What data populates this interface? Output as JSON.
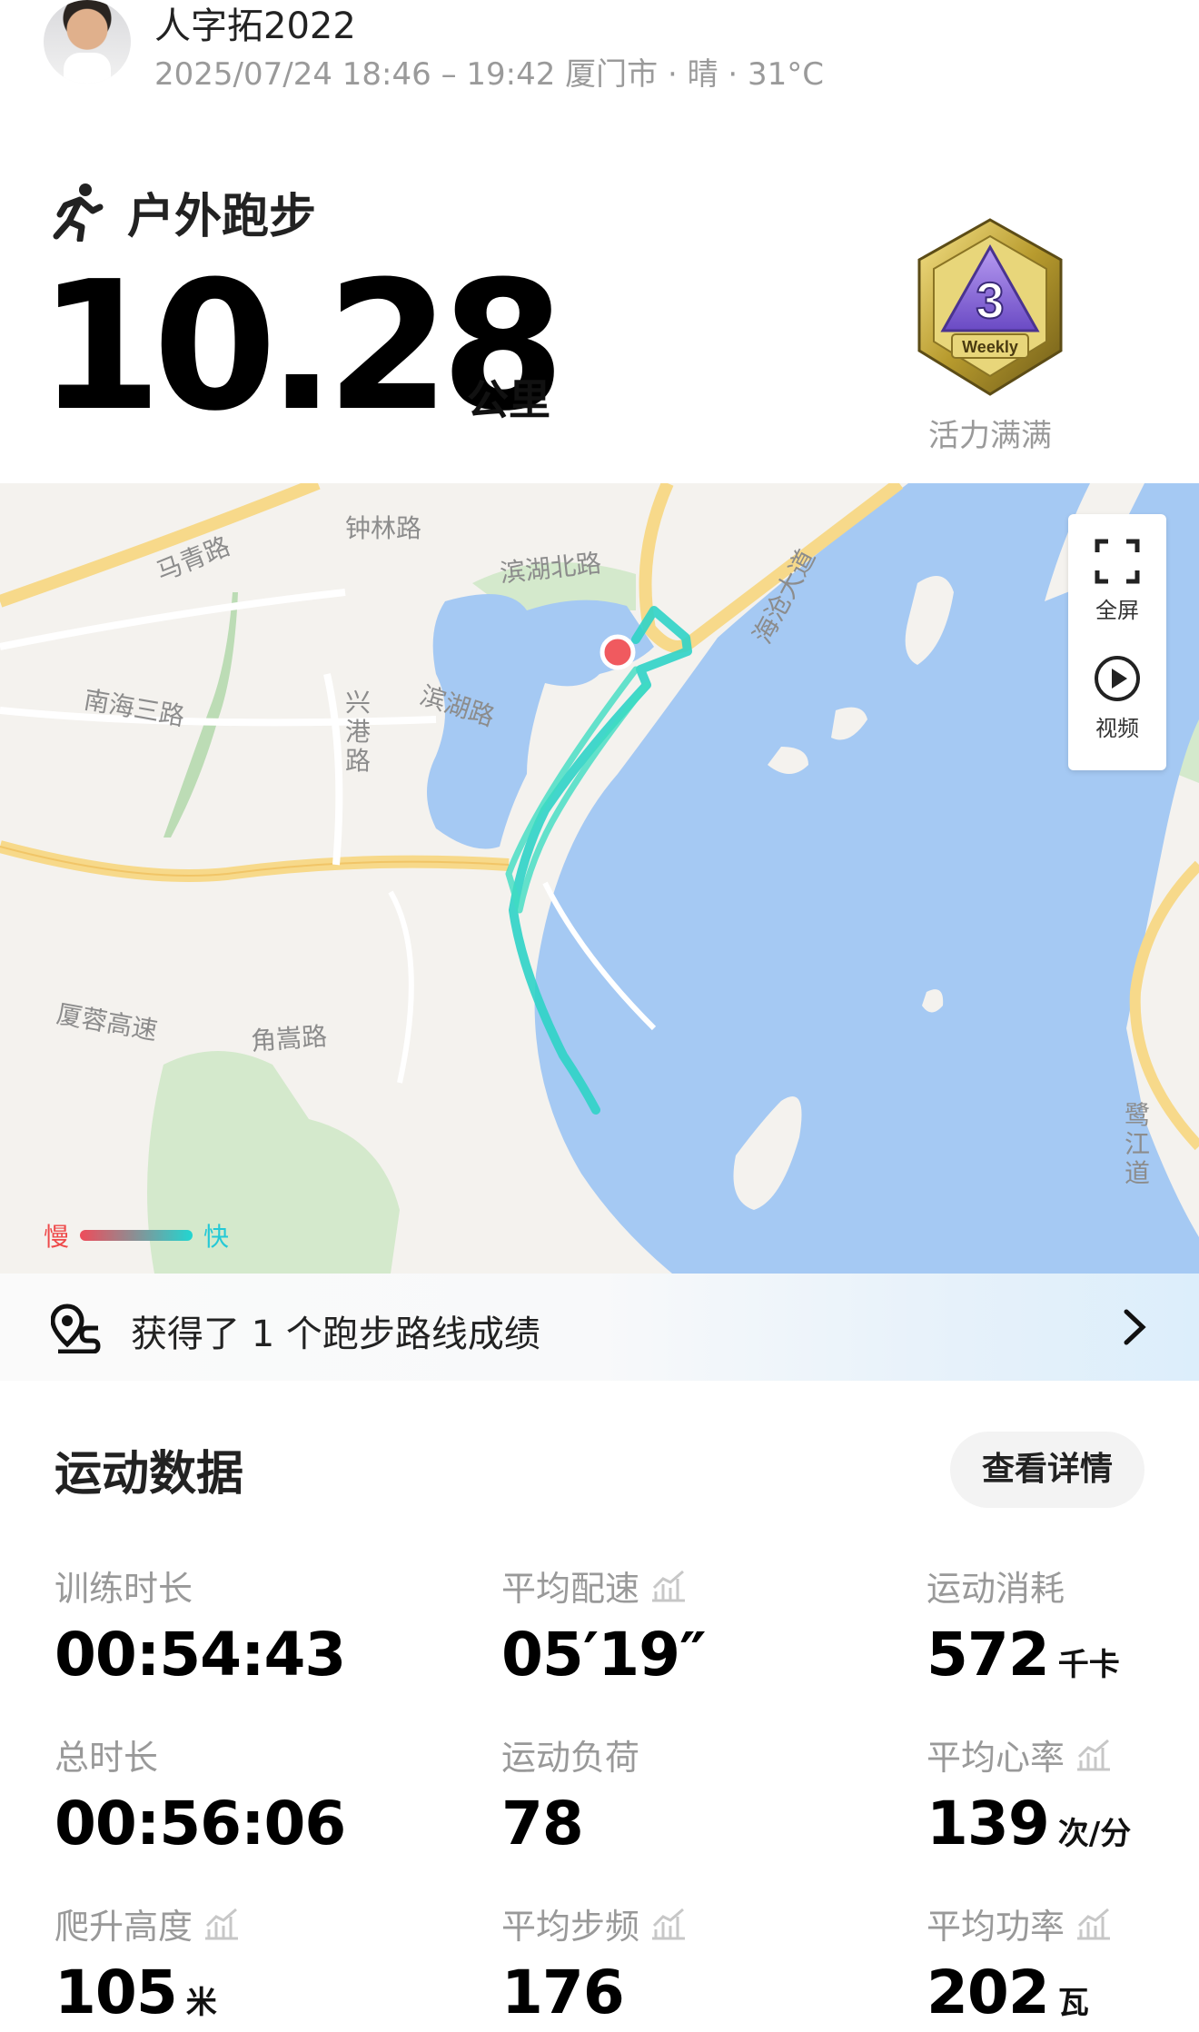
{
  "header": {
    "username": "人字拓2022",
    "meta": "2025/07/24 18:46 – 19:42 厦门市 · 晴 · 31°C"
  },
  "activity": {
    "sport": "户外跑步",
    "distance": "10.28",
    "unit": "公里",
    "badge_text": "Weekly",
    "badge_label": "活力满满"
  },
  "map": {
    "labels": {
      "zhonglin": "钟林路",
      "maqing": "马青路",
      "binhu_north": "滨湖北路",
      "haicang": "海沧大道",
      "nanhai3": "南海三路",
      "xinggang": "兴港路",
      "binhu": "滨湖路",
      "xiamen_exp": "厦蓉高速",
      "jiaosong": "角嵩路",
      "lujiang": "鹭江道"
    },
    "fullscreen": "全屏",
    "video": "视频",
    "slow": "慢",
    "fast": "快"
  },
  "route": {
    "text": "获得了 1 个跑步路线成绩"
  },
  "data": {
    "title": "运动数据",
    "detail_button": "查看详情",
    "stats": {
      "duration": {
        "label": "训练时长",
        "value": "00:54:43"
      },
      "pace": {
        "label": "平均配速",
        "value": "05′19″"
      },
      "calories": {
        "label": "运动消耗",
        "value": "572",
        "unit": "千卡"
      },
      "total_time": {
        "label": "总时长",
        "value": "00:56:06"
      },
      "load": {
        "label": "运动负荷",
        "value": "78"
      },
      "heart_rate": {
        "label": "平均心率",
        "value": "139",
        "unit": "次/分"
      },
      "elevation": {
        "label": "爬升高度",
        "value": "105",
        "unit": "米"
      },
      "cadence": {
        "label": "平均步频",
        "value": "176"
      },
      "power": {
        "label": "平均功率",
        "value": "202",
        "unit": "瓦"
      }
    }
  },
  "colors": {
    "route": "#2fd3c6",
    "water": "#a5c9f3",
    "park": "#cfe6c7",
    "road": "#f7d98a",
    "start_marker": "#f05a5f"
  }
}
